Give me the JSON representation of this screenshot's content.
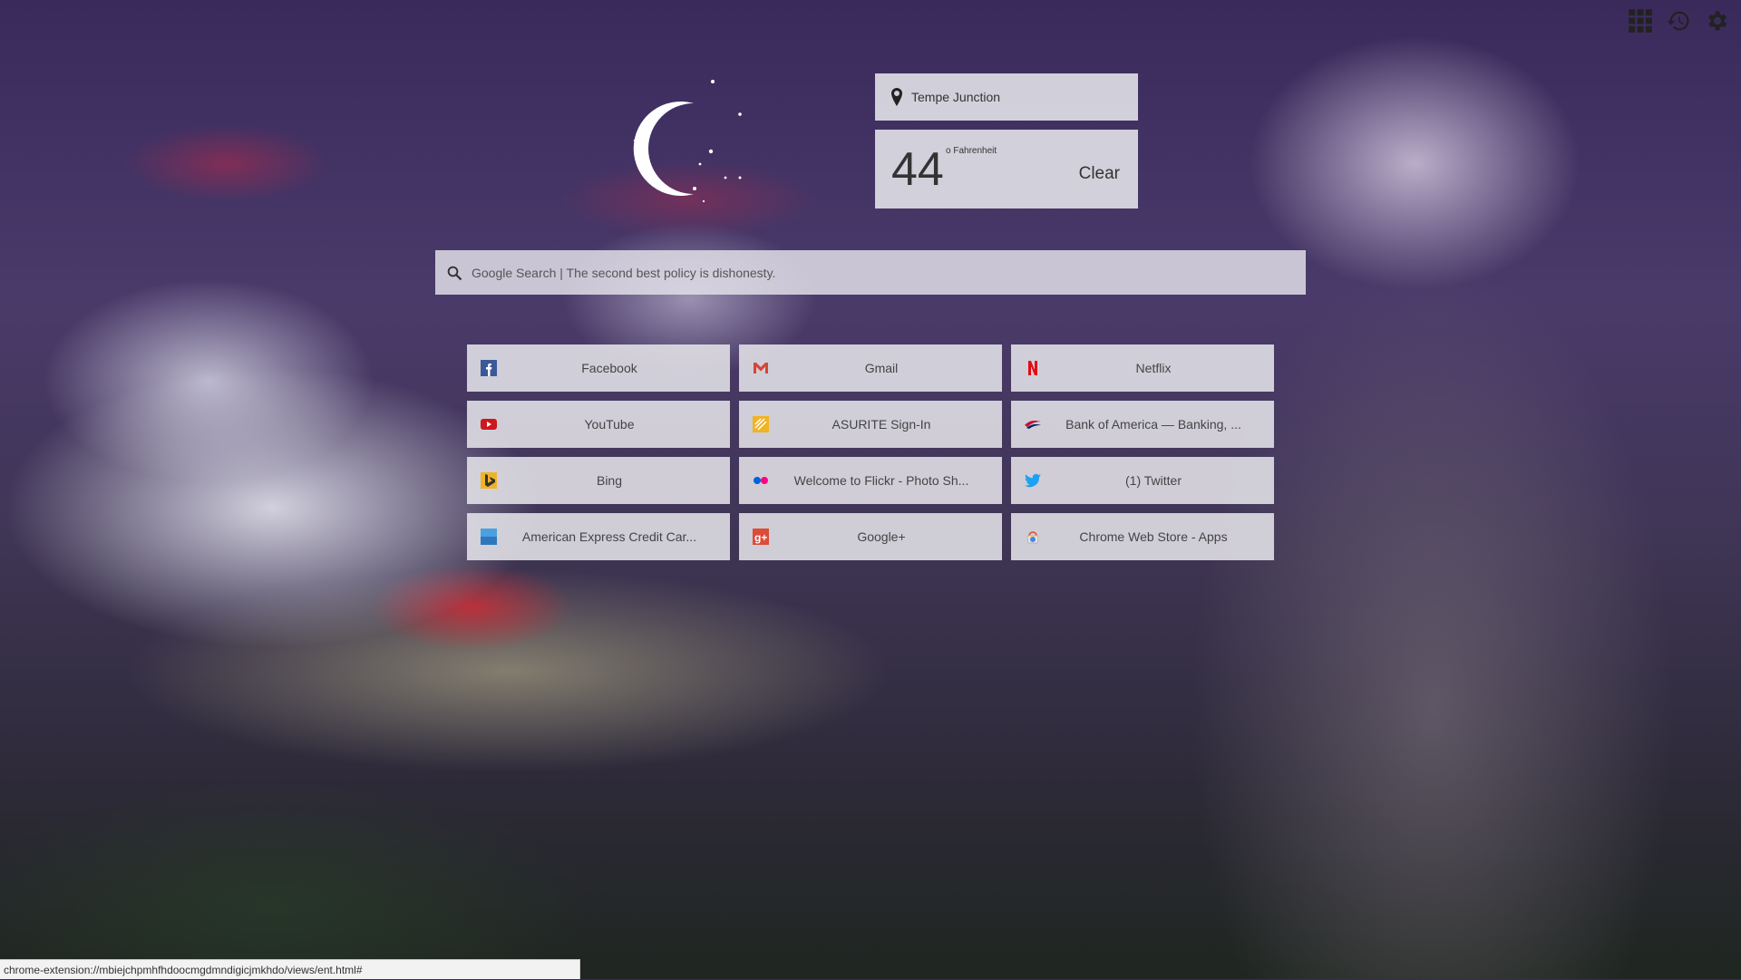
{
  "toolbar": {
    "apps_icon": "apps-grid-icon",
    "history_icon": "history-icon",
    "settings_icon": "gear-icon"
  },
  "weather": {
    "location": "Tempe Junction",
    "temperature": "44",
    "unit": "o Fahrenheit",
    "condition": "Clear",
    "icon": "moon-stars-icon"
  },
  "search": {
    "placeholder": "Google Search | The second best policy is dishonesty."
  },
  "tiles": [
    {
      "label": "Facebook",
      "icon": "facebook-icon",
      "color": "#3b5998"
    },
    {
      "label": "Gmail",
      "icon": "gmail-icon",
      "color": "#d14836"
    },
    {
      "label": "Netflix",
      "icon": "netflix-icon",
      "color": "#e50914"
    },
    {
      "label": "YouTube",
      "icon": "youtube-icon",
      "color": "#cc181e"
    },
    {
      "label": "ASURITE Sign-In",
      "icon": "asurite-icon",
      "color": "#f0b323"
    },
    {
      "label": "Bank of America — Banking, ...",
      "icon": "bank-of-america-icon",
      "color": "#c41230"
    },
    {
      "label": "Bing",
      "icon": "bing-icon",
      "color": "#f0b323"
    },
    {
      "label": "Welcome to Flickr - Photo Sh...",
      "icon": "flickr-icon",
      "color": "#ff0084"
    },
    {
      "label": "(1) Twitter",
      "icon": "twitter-icon",
      "color": "#1da1f2"
    },
    {
      "label": "American Express Credit Car...",
      "icon": "amex-icon",
      "color": "#2e77bc"
    },
    {
      "label": "Google+",
      "icon": "google-plus-icon",
      "color": "#dd4b39"
    },
    {
      "label": "Chrome Web Store - Apps",
      "icon": "chrome-web-store-icon",
      "color": "#4285f4"
    }
  ],
  "status_bar": {
    "url": "chrome-extension://mbiejchpmhfhdoocmgdmndigicjmkhdo/views/ent.html#"
  }
}
